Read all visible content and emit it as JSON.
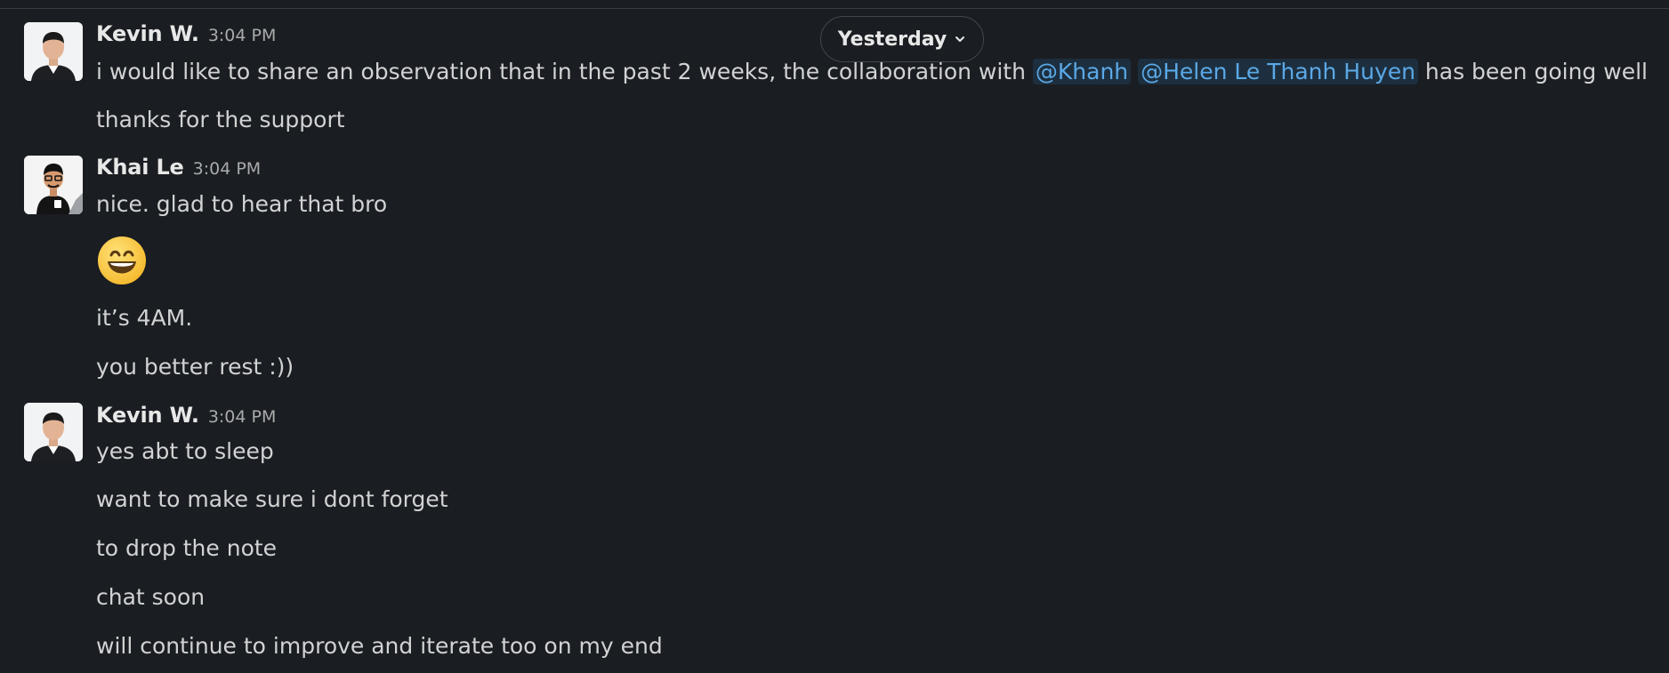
{
  "date_divider": {
    "label": "Yesterday",
    "icon": "chevron-down-icon"
  },
  "messages": [
    {
      "author": "Kevin W.",
      "time": "3:04 PM",
      "avatar": "avatar-kevin",
      "lines": [
        {
          "pre": "i would like to share an observation that in the past 2 weeks, the collaboration with ",
          "mention1": "@Khanh",
          "mid": " ",
          "mention2": "@Helen Le Thanh Huyen",
          "post": " has been going well"
        },
        {
          "text": "thanks for the support"
        }
      ]
    },
    {
      "author": "Khai Le",
      "time": "3:04 PM",
      "avatar": "avatar-khai",
      "lines": [
        {
          "text": "nice. glad to hear that bro"
        },
        {
          "emoji": "grinning-face-emoji"
        },
        {
          "text": "it’s 4AM."
        },
        {
          "text": "you better rest :))"
        }
      ]
    },
    {
      "author": "Kevin W.",
      "time": "3:04 PM",
      "avatar": "avatar-kevin",
      "lines": [
        {
          "text": "yes abt to sleep"
        },
        {
          "text": "want to make sure i dont forget"
        },
        {
          "text": "to drop the note"
        },
        {
          "text": "chat soon"
        },
        {
          "text": "will continue to improve and iterate too on my end"
        }
      ]
    }
  ],
  "colors": {
    "background": "#1a1d21",
    "text": "#d1d2d3",
    "author": "#e8e8e8",
    "timestamp": "#a9aaab",
    "mention": "#5ba8e6",
    "mention_bg": "#1d2f3f"
  }
}
